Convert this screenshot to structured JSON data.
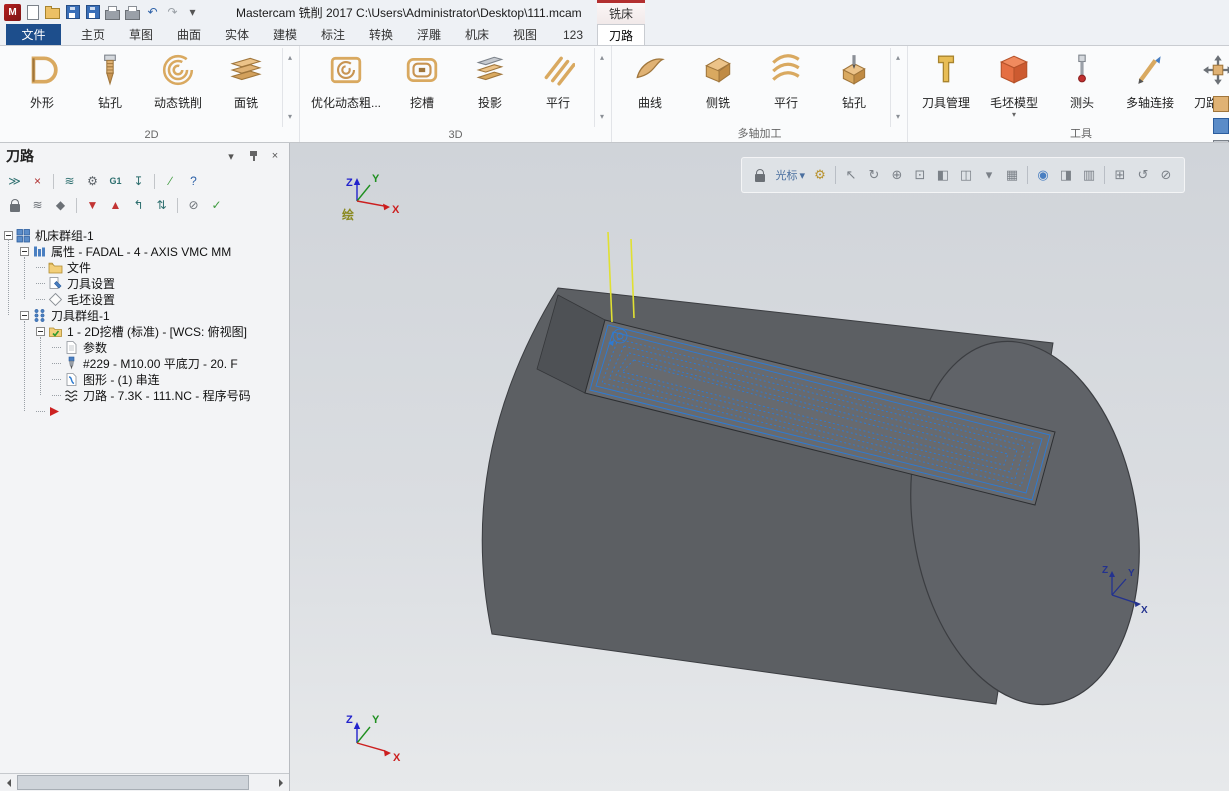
{
  "colors": {
    "accent_blue": "#2f7ad0",
    "stock_gray": "#5c5f63",
    "context_red": "#b32f2f",
    "tool_yellow": "#e0e032"
  },
  "title_bar": {
    "app_title": "Mastercam 铣削 2017  C:\\Users\\Administrator\\Desktop\\111.mcam",
    "context_tab": "铣床",
    "quick_access": [
      {
        "name": "new-file",
        "shape": "page"
      },
      {
        "name": "open-file",
        "shape": "folder"
      },
      {
        "name": "save",
        "shape": "disk"
      },
      {
        "name": "save-as",
        "shape": "disk"
      },
      {
        "name": "print",
        "shape": "printer"
      },
      {
        "name": "print-preview",
        "shape": "printer"
      },
      {
        "name": "undo",
        "glyph": "↶",
        "color": "#2d61a8"
      },
      {
        "name": "redo",
        "glyph": "↷",
        "color": "#9aa0a6"
      },
      {
        "name": "customize-quick-access",
        "glyph": "▾",
        "color": "#555555"
      }
    ]
  },
  "ribbon": {
    "file_tab": "文件",
    "tabs": [
      "主页",
      "草图",
      "曲面",
      "实体",
      "建模",
      "标注",
      "转换",
      "浮雕",
      "机床",
      "视图",
      "123",
      "刀路"
    ],
    "active_tab": "刀路",
    "more_up": "▴",
    "more_down": "▾",
    "groups": [
      {
        "label": "2D",
        "more_arrows": true,
        "buttons": [
          {
            "name": "contour-button",
            "icon": "contour",
            "label": "外形"
          },
          {
            "name": "drill-button",
            "icon": "drill",
            "label": "钻孔"
          },
          {
            "name": "dynamic-mill-button",
            "icon": "spiral",
            "label": "动态铣削"
          },
          {
            "name": "face-mill-button",
            "icon": "facemill",
            "label": "面铣"
          }
        ]
      },
      {
        "label": "3D",
        "more_arrows": true,
        "buttons": [
          {
            "name": "opti-rough-button",
            "icon": "optirough",
            "label": "优化动态粗..."
          },
          {
            "name": "pocket-button",
            "icon": "pocket",
            "label": "挖槽"
          },
          {
            "name": "project-button",
            "icon": "project",
            "label": "投影"
          },
          {
            "name": "parallel-button",
            "icon": "parallel",
            "label": "平行"
          }
        ]
      },
      {
        "label": "多轴加工",
        "more_arrows": true,
        "buttons": [
          {
            "name": "curve-5axis-button",
            "icon": "curve",
            "label": "曲线"
          },
          {
            "name": "swarf-mill-button",
            "icon": "swarf",
            "label": "侧铣"
          },
          {
            "name": "multiaxis-parallel-button",
            "icon": "mparallel",
            "label": "平行"
          },
          {
            "name": "multiaxis-drill-button",
            "icon": "mdrill",
            "label": "钻孔"
          }
        ]
      },
      {
        "label": "工具",
        "more_arrows": false,
        "buttons": [
          {
            "name": "tool-manager-button",
            "icon": "toolmgr",
            "label": "刀具管理"
          },
          {
            "name": "stock-model-button",
            "icon": "stock",
            "label": "毛坯模型",
            "dropdown": true
          },
          {
            "name": "probe-button",
            "icon": "probe",
            "label": "测头"
          },
          {
            "name": "multiaxis-link-button",
            "icon": "axislink",
            "label": "多轴连接"
          },
          {
            "name": "toolpath-transform-button",
            "icon": "transform",
            "label": "刀路转换"
          }
        ]
      }
    ]
  },
  "toolpath_panel": {
    "title": "刀路",
    "menu_glyph": "▾",
    "close_glyph": "×",
    "toolbar_row1": [
      {
        "name": "select-all-operations",
        "glyph": "≫",
        "color": "#2e6f6f"
      },
      {
        "name": "select-none",
        "glyph": "×",
        "color": "#b03030"
      },
      {
        "divider": true
      },
      {
        "name": "regenerate-selected",
        "glyph": "≋",
        "color": "#2e6f6f"
      },
      {
        "name": "regenerate-all",
        "glyph": "⚙",
        "color": "#5a6066"
      },
      {
        "name": "backplot-g1",
        "text": "G1",
        "color": "#2e6f6f"
      },
      {
        "name": "verify",
        "glyph": "↧",
        "color": "#2e6f6f"
      },
      {
        "divider": true
      },
      {
        "name": "edit-operation",
        "glyph": "∕",
        "color": "#3f9b3f"
      },
      {
        "name": "help",
        "glyph": "?",
        "color": "#2d61a8"
      }
    ],
    "toolbar_row2": [
      {
        "name": "lock-operations",
        "shape": "lock"
      },
      {
        "name": "toggle-toolpath-display",
        "glyph": "≋",
        "color": "#6b7076"
      },
      {
        "name": "toggle-post",
        "glyph": "◆",
        "color": "#6b7076"
      },
      {
        "divider": true
      },
      {
        "name": "move-insert-down",
        "glyph": "▼",
        "color": "#c23434"
      },
      {
        "name": "move-insert-up",
        "glyph": "▲",
        "color": "#c23434"
      },
      {
        "name": "insert-arrow-up",
        "glyph": "↰",
        "color": "#2e6f6f"
      },
      {
        "name": "scroll-insert",
        "glyph": "⇅",
        "color": "#2e6f6f"
      },
      {
        "divider": true
      },
      {
        "name": "only-display-selected",
        "glyph": "⊘",
        "color": "#6b7076"
      },
      {
        "name": "advanced-display",
        "glyph": "✓",
        "color": "#3f9b3f"
      }
    ],
    "tree": {
      "items": [
        {
          "name": "machine-group",
          "label": "机床群组-1",
          "level": 0,
          "icon": "machine-group",
          "expander": true
        },
        {
          "name": "properties",
          "label": "属性 - FADAL - 4 - AXIS VMC MM",
          "level": 1,
          "icon": "properties",
          "expander": true
        },
        {
          "name": "files",
          "label": "文件",
          "level": 2,
          "icon": "folder"
        },
        {
          "name": "tool-settings",
          "label": "刀具设置",
          "level": 2,
          "icon": "tool-settings"
        },
        {
          "name": "stock-setup",
          "label": "毛坯设置",
          "level": 2,
          "icon": "diamond"
        },
        {
          "name": "toolpath-group",
          "label": "刀具群组-1",
          "level": 1,
          "icon": "tool-group",
          "expander": true
        },
        {
          "name": "operation-1",
          "label": "1 - 2D挖槽 (标准) - [WCS: 俯视图]",
          "level": 2,
          "icon": "operation",
          "expander": true
        },
        {
          "name": "parameters",
          "label": "参数",
          "level": 3,
          "icon": "page"
        },
        {
          "name": "tool-definition",
          "label": "#229 - M10.00 平底刀 - 20. F",
          "level": 3,
          "icon": "tool"
        },
        {
          "name": "geometry",
          "label": "图形 - (1) 串连",
          "level": 3,
          "icon": "geometry"
        },
        {
          "name": "toolpath-data",
          "label": "刀路 - 7.3K - 111.NC - 程序号码",
          "level": 3,
          "icon": "toolpath"
        },
        {
          "name": "insert-position",
          "label": "",
          "level": 2,
          "icon": "insert-arrow"
        }
      ]
    }
  },
  "viewport": {
    "axis_x": "X",
    "axis_y": "Y",
    "axis_z": "Z",
    "plane_label": "绘",
    "cursor_tool_label": "光标",
    "overlay_toolbar": [
      {
        "name": "lock-view",
        "shape": "lock"
      },
      {
        "name": "cursor-mode",
        "text": "光标",
        "dropdown": true
      },
      {
        "name": "gnomon-settings",
        "glyph": "⚙",
        "color": "#b8922e"
      },
      {
        "divider": true
      },
      {
        "name": "select-pointer",
        "glyph": "↖",
        "color": "#7b8188"
      },
      {
        "name": "dynamic-rotate",
        "glyph": "↻",
        "color": "#7b8188"
      },
      {
        "name": "pan",
        "glyph": "⊕",
        "color": "#7b8188"
      },
      {
        "name": "zoom-window",
        "glyph": "⊡",
        "color": "#7b8188"
      },
      {
        "name": "view-front",
        "glyph": "◧",
        "color": "#7b8188"
      },
      {
        "name": "view-isometric",
        "glyph": "◫",
        "color": "#7b8188"
      },
      {
        "name": "views-dropdown",
        "glyph": "▾",
        "color": "#7b8188"
      },
      {
        "name": "grid",
        "glyph": "▦",
        "color": "#7b8188"
      },
      {
        "divider": true
      },
      {
        "name": "shading",
        "glyph": "◉",
        "color": "#4a7fc1"
      },
      {
        "name": "section-view",
        "glyph": "◨",
        "color": "#7b8188"
      },
      {
        "name": "translucency",
        "glyph": "▥",
        "color": "#7b8188"
      },
      {
        "divider": true
      },
      {
        "name": "viewsheet",
        "glyph": "⊞",
        "color": "#7b8188"
      },
      {
        "name": "refresh",
        "glyph": "↺",
        "color": "#7b8188"
      },
      {
        "name": "blank",
        "glyph": "⊘",
        "color": "#7b8188"
      }
    ]
  }
}
